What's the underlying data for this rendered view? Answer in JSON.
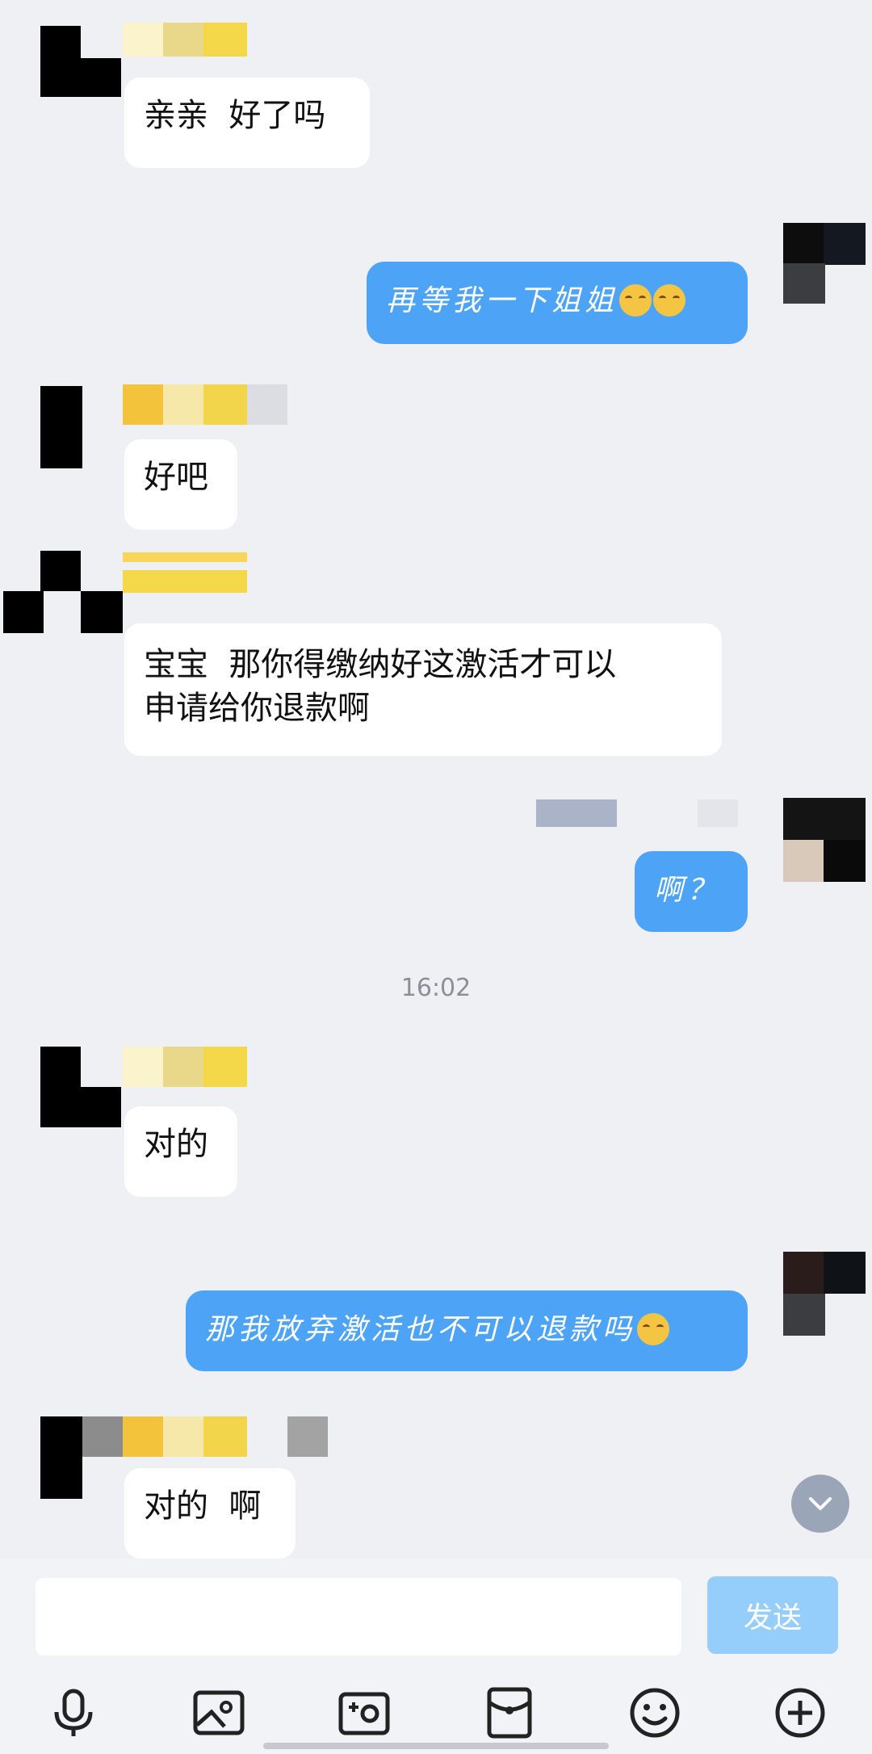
{
  "messages": [
    {
      "side": "in",
      "text": "亲亲  好了吗"
    },
    {
      "side": "out",
      "text": "再等我一下姐姐",
      "emoji_count": 2
    },
    {
      "side": "in",
      "text": "好吧"
    },
    {
      "side": "in",
      "text": "宝宝  那你得缴纳好这激活才可以\n申请给你退款啊"
    },
    {
      "side": "out",
      "text": "啊？"
    },
    {
      "side": "in",
      "text": "对的"
    },
    {
      "side": "out",
      "text": "那我放弃激活也不可以退款吗",
      "emoji_count": 1
    },
    {
      "side": "in",
      "text": "对的  啊"
    }
  ],
  "timestamp": "16:02",
  "input": {
    "value": "",
    "placeholder": ""
  },
  "send_label": "发送",
  "toolbar_icons": [
    "microphone-icon",
    "image-icon",
    "camera-icon",
    "red-packet-icon",
    "emoji-icon",
    "plus-icon"
  ],
  "colors": {
    "outgoing_bubble": "#4da3f5",
    "send_button": "#95cdfb",
    "background": "#eef0f4"
  }
}
